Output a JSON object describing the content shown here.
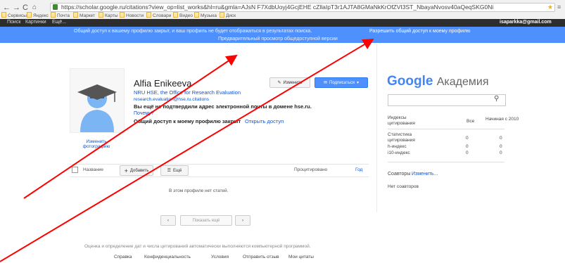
{
  "browser": {
    "url": "https://scholar.google.ru/citations?view_op=list_works&hl=ru&gmla=AJsN F7XdbUoyj4GcjEHE cZllaIpT3r1AJTA8GMaNkKrOfZVI3ST_NbayaNvosv40aQeqSKG0Ni",
    "bookmarks": [
      "Сервисы",
      "Яндекс",
      "Почта",
      "Маркет",
      "Карты",
      "Новости",
      "Словари",
      "Видео",
      "Музыка",
      "Диск"
    ]
  },
  "gbar": {
    "links": [
      "Поиск",
      "Картинки",
      "Ещё..."
    ],
    "account": "isaparkka@gmail.com"
  },
  "notice": {
    "line1": "Общий доступ к вашему профилю закрыт, и ваш профиль не будет отображаться в результатах поиска.",
    "line1_link": "Разрешить общий доступ к моему профилю",
    "line2": "Предварительный просмотр общедоступной версии"
  },
  "profile": {
    "name": "Alfia Enikeeva",
    "affiliation": "NRU HSE, the Office for Research Evaluation",
    "email_line": "research.evaluation@hse.ru.citations",
    "warning": "Вы ещё не подтвердили адрес электронной почты в домене hse.ru.",
    "why": "Почему?",
    "closed": "Общий доступ к моему профилю закрыт",
    "open_link": "Открыть доступ",
    "change_photo": "Изменить фотографию",
    "edit_btn": "Изменить",
    "follow_btn": "Подписаться"
  },
  "toolbar": {
    "select_label": "Название",
    "add_label": "Добавить",
    "more_label": "Ещё",
    "cited_header": "Процитировано",
    "year_header": "Год"
  },
  "articles": {
    "empty": "В этом профиле нет статей.",
    "pager_label": "Показать ещё"
  },
  "sidebar": {
    "logo_google": "Google",
    "logo_scholar": "Академия",
    "search_placeholder": "",
    "col_all": "Все",
    "col_since": "Начиная с 2010",
    "rows": [
      {
        "label": "Индексы цитирования",
        "all": "",
        "since": ""
      },
      {
        "label": "Статистика цитирования",
        "all": "0",
        "since": "0"
      },
      {
        "label": "h-индекс",
        "all": "0",
        "since": "0"
      },
      {
        "label": "i10-индекс",
        "all": "0",
        "since": "0"
      }
    ],
    "coauthors_label": "Соавторы",
    "coauthors_edit": "Изменить...",
    "no_coauthors": "Нет соавторов"
  },
  "footer": {
    "note": "Оценка и определение дат и числа цитирований автоматически выполняются компьютерной программой.",
    "links": [
      "Справка",
      "Конфиденциальность",
      "Условия",
      "Отправить отзыв",
      "Мои цитаты"
    ]
  },
  "colors": {
    "notice_bg": "#4d90fe",
    "gbar_bg": "#2d2d2d",
    "annotation": "#ff0000",
    "link": "#1155cc"
  }
}
